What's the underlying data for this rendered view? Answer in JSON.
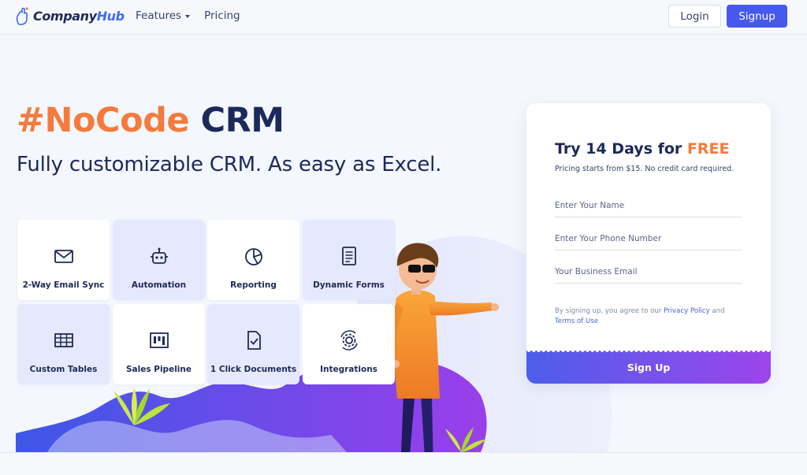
{
  "brand": {
    "logo_text_company": "Company",
    "logo_text_hub": "Hub"
  },
  "nav": {
    "items": [
      {
        "label": "Features",
        "has_dropdown": true
      },
      {
        "label": "Pricing",
        "has_dropdown": false
      }
    ],
    "login_label": "Login",
    "signup_label": "Signup"
  },
  "hero": {
    "title_highlight": "#NoCode",
    "title_rest": "CRM",
    "subtitle": "Fully customizable CRM. As easy as Excel."
  },
  "features": [
    {
      "label": "2-Way Email Sync",
      "icon": "envelope-icon"
    },
    {
      "label": "Automation",
      "icon": "robot-icon"
    },
    {
      "label": "Reporting",
      "icon": "pie-chart-icon"
    },
    {
      "label": "Dynamic Forms",
      "icon": "document-form-icon"
    },
    {
      "label": "Custom Tables",
      "icon": "table-grid-icon"
    },
    {
      "label": "Sales Pipeline",
      "icon": "kanban-icon"
    },
    {
      "label": "1 Click Documents",
      "icon": "document-check-icon"
    },
    {
      "label": "Integrations",
      "icon": "gear-sync-icon"
    }
  ],
  "signup_card": {
    "title_prefix": "Try 14 Days for",
    "title_highlight": "FREE",
    "subtitle": "Pricing starts from $15. No credit card required.",
    "name_placeholder": "Enter Your Name",
    "phone_placeholder": "Enter Your Phone Number",
    "email_placeholder": "Your Business Email",
    "terms_prefix": "By signing up, you agree to our",
    "privacy_label": "Privacy Policy",
    "terms_and": "and",
    "terms_label": "Terms of Use",
    "submit_label": "Sign Up"
  },
  "colors": {
    "accent": "#4659ee",
    "highlight": "#f47b3c",
    "navy": "#1b2a5b",
    "tile_blue": "#e5e9fd"
  }
}
